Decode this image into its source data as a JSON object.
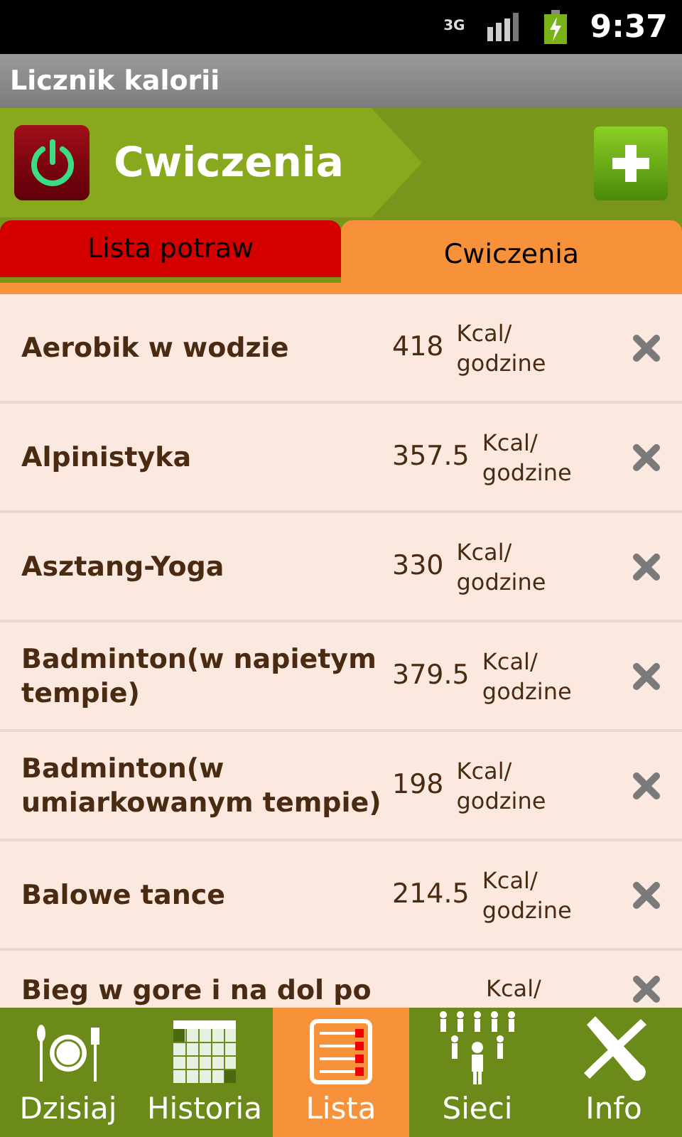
{
  "status_bar": {
    "network": "3G",
    "time": "9:37"
  },
  "app_title": "Licznik kalorii",
  "header": {
    "title": "Cwiczenia"
  },
  "tabs": [
    {
      "label": "Lista potraw",
      "selected": false
    },
    {
      "label": "Cwiczenia",
      "selected": true
    }
  ],
  "rows": [
    {
      "name": "Aerobik w wodzie",
      "value": "418",
      "unit": "Kcal/ godzine"
    },
    {
      "name": "Alpinistyka",
      "value": "357.5",
      "unit": "Kcal/ godzine"
    },
    {
      "name": "Asztang-Yoga",
      "value": "330",
      "unit": "Kcal/ godzine"
    },
    {
      "name": "Badminton(w napietym tempie)",
      "value": "379.5",
      "unit": "Kcal/ godzine"
    },
    {
      "name": "Badminton(w umiarkowanym tempie)",
      "value": "198",
      "unit": "Kcal/ godzine"
    },
    {
      "name": "Balowe tance",
      "value": "214.5",
      "unit": "Kcal/ godzine"
    },
    {
      "name": "Bieg w gore i na dol po",
      "unit": "Kcal/"
    }
  ],
  "nav": [
    {
      "kind": "plate",
      "label": "Dzisiaj",
      "selected": false
    },
    {
      "kind": "calendar",
      "label": "Historia",
      "selected": false
    },
    {
      "kind": "list",
      "label": "Lista",
      "selected": true
    },
    {
      "kind": "people",
      "label": "Sieci",
      "selected": false
    },
    {
      "kind": "tools",
      "label": "Info",
      "selected": false
    }
  ]
}
